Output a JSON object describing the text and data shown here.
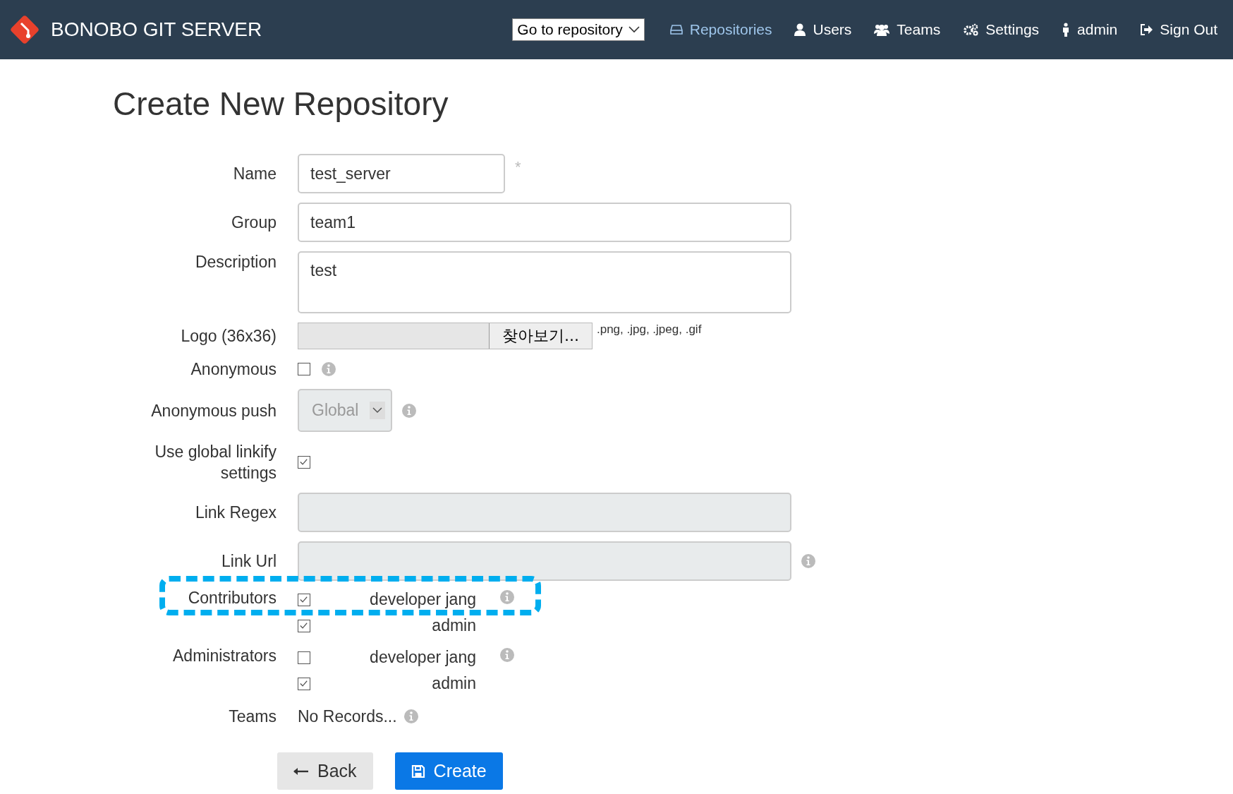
{
  "header": {
    "brand": "BONOBO GIT SERVER",
    "repo_select": "Go to repository",
    "nav": [
      {
        "kind": "drive",
        "label": "Repositories",
        "selected": true
      },
      {
        "kind": "user",
        "label": "Users",
        "selected": false
      },
      {
        "kind": "group",
        "label": "Teams",
        "selected": false
      },
      {
        "kind": "gears",
        "label": "Settings",
        "selected": false
      },
      {
        "kind": "person",
        "label": "admin",
        "selected": false
      },
      {
        "kind": "signout",
        "label": "Sign Out",
        "selected": false
      }
    ]
  },
  "form": {
    "title": "Create New Repository",
    "fields": [
      {
        "kind": "text",
        "label": "Name",
        "value": "test_server",
        "short": true,
        "required_mark": "*"
      },
      {
        "kind": "text",
        "label": "Group",
        "value": "team1"
      },
      {
        "kind": "textarea",
        "label": "Description",
        "value": "test"
      },
      {
        "kind": "file",
        "label": "Logo (36x36)",
        "button": "찾아보기...",
        "hint": ".png, .jpg, .jpeg, .gif"
      },
      {
        "kind": "checkbox",
        "label": "Anonymous",
        "checked": false,
        "info": true
      },
      {
        "kind": "select",
        "label": "Anonymous push",
        "value": "Global",
        "disabled": true,
        "info": true
      },
      {
        "kind": "checkbox",
        "label": "Use global linkify settings",
        "checked": true
      },
      {
        "kind": "text",
        "label": "Link Regex",
        "disabled": true
      },
      {
        "kind": "text",
        "label": "Link Url",
        "disabled": true,
        "info": true
      },
      {
        "kind": "userlist",
        "label": "Contributors",
        "highlighted": true,
        "info": true,
        "users": [
          {
            "name": "developer jang",
            "checked": true
          },
          {
            "name": "admin",
            "checked": true
          }
        ]
      },
      {
        "kind": "userlist",
        "label": "Administrators",
        "info": true,
        "users": [
          {
            "name": "developer jang",
            "checked": false
          },
          {
            "name": "admin",
            "checked": true
          }
        ]
      },
      {
        "kind": "note",
        "label": "Teams",
        "value": "No Records...",
        "info": true
      }
    ],
    "buttons": [
      {
        "kind": "back",
        "label": "Back"
      },
      {
        "kind": "create",
        "label": "Create"
      }
    ]
  }
}
